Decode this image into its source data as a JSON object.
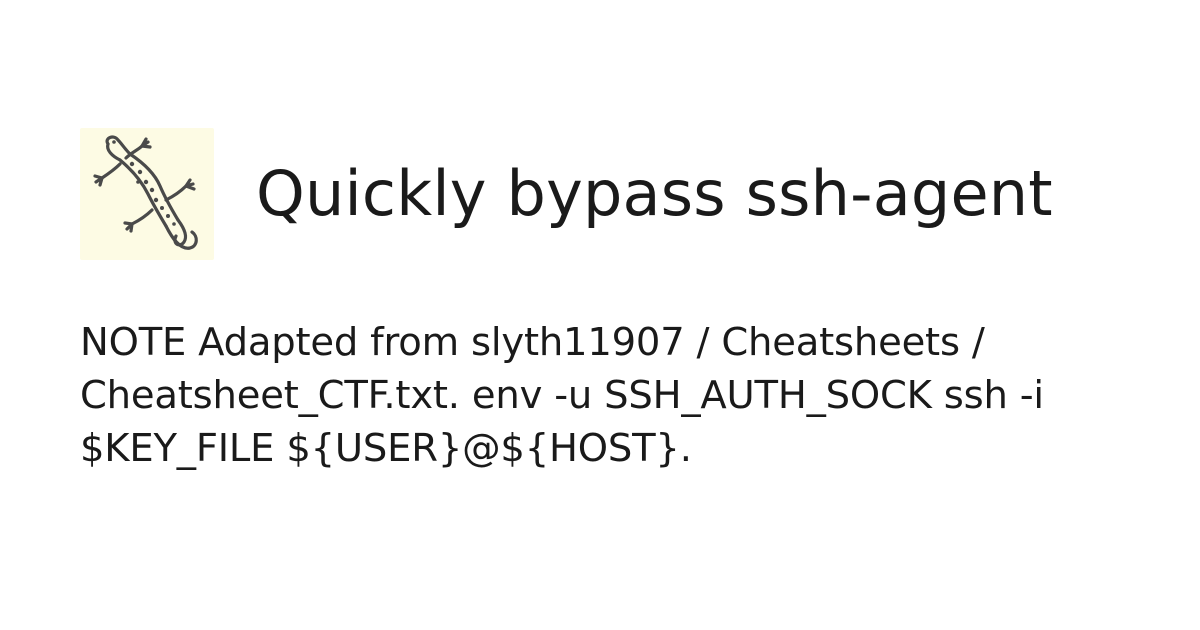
{
  "page": {
    "title": "Quickly bypass ssh-agent",
    "description": "NOTE Adapted from slyth11907 / Cheatsheets / Cheatsheet_CTF.txt. env -u SSH_AUTH_SOCK ssh -i $KEY_FILE ${USER}@${HOST}.",
    "logo_icon": "lizard-icon"
  },
  "colors": {
    "background": "#ffffff",
    "text": "#1a1a1a",
    "logo_background": "#fdfbe4",
    "logo_stroke": "#4a4a4a"
  }
}
